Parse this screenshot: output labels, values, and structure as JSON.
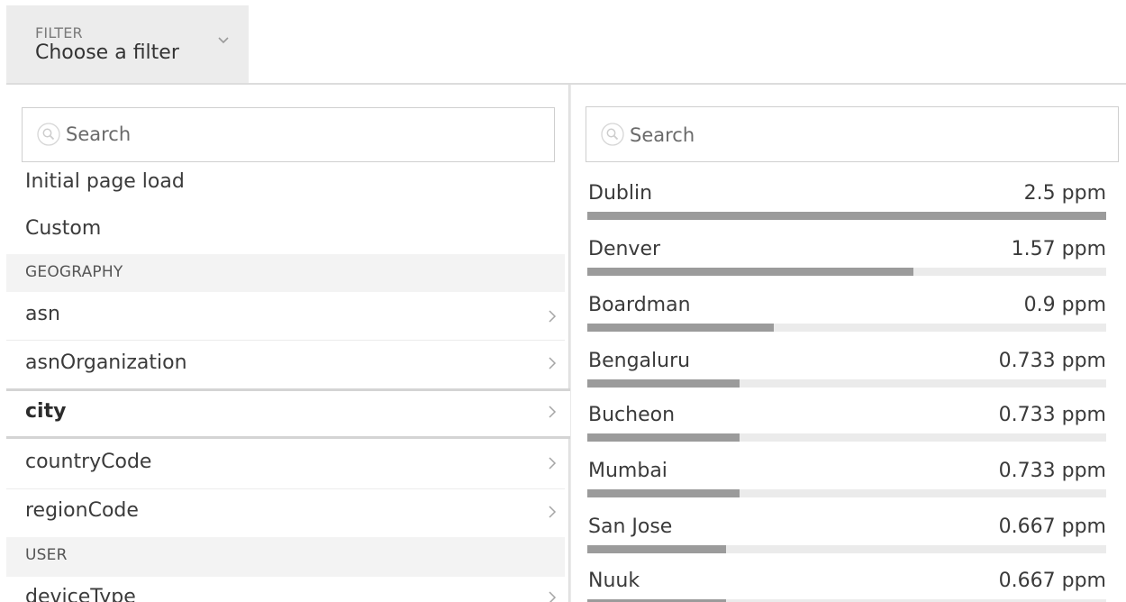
{
  "filter": {
    "caption": "FILTER",
    "value": "Choose a filter",
    "chevron_icon": "chevron-down-icon"
  },
  "left_panel": {
    "search_placeholder": "Search",
    "items": {
      "initial_page_load": "Initial page load",
      "custom": "Custom"
    },
    "geography": {
      "header": "GEOGRAPHY",
      "asn": "asn",
      "asn_organization": "asnOrganization",
      "city": "city",
      "country_code": "countryCode",
      "region_code": "regionCode"
    },
    "user": {
      "header": "USER",
      "device_type": "deviceType"
    },
    "selected": "city"
  },
  "right_panel": {
    "search_placeholder": "Search",
    "results": [
      {
        "name": "Dublin",
        "value": "2.5 ppm",
        "fraction": 1.0
      },
      {
        "name": "Denver",
        "value": "1.57 ppm",
        "fraction": 0.628
      },
      {
        "name": "Boardman",
        "value": "0.9 ppm",
        "fraction": 0.36
      },
      {
        "name": "Bengaluru",
        "value": "0.733 ppm",
        "fraction": 0.293
      },
      {
        "name": "Bucheon",
        "value": "0.733 ppm",
        "fraction": 0.293
      },
      {
        "name": "Mumbai",
        "value": "0.733 ppm",
        "fraction": 0.293
      },
      {
        "name": "San Jose",
        "value": "0.667 ppm",
        "fraction": 0.267
      },
      {
        "name": "Nuuk",
        "value": "0.667 ppm",
        "fraction": 0.267
      }
    ]
  },
  "colors": {
    "bar_fill": "#9b9b9b",
    "bar_track": "#ebebeb",
    "section_bg": "#f3f3f3"
  }
}
